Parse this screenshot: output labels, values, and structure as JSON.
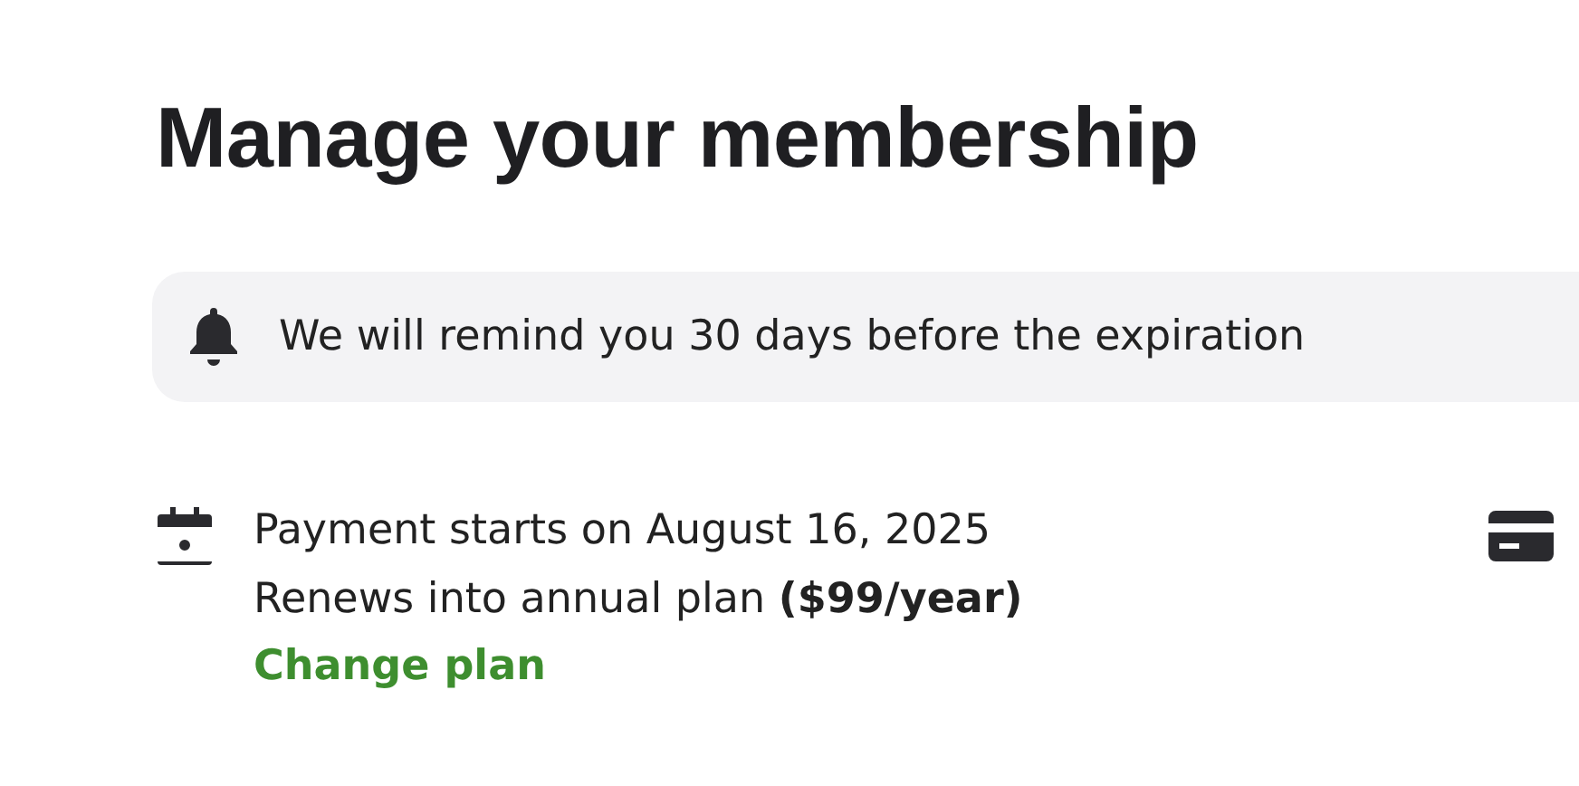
{
  "title": "Manage your membership",
  "notice": {
    "text": "We will remind you 30 days before the expiration"
  },
  "payment": {
    "lines": [
      "Payment starts on August 16, 2025",
      "Renews into annual plan **($99/year)**"
    ],
    "link": "Change plan"
  }
}
